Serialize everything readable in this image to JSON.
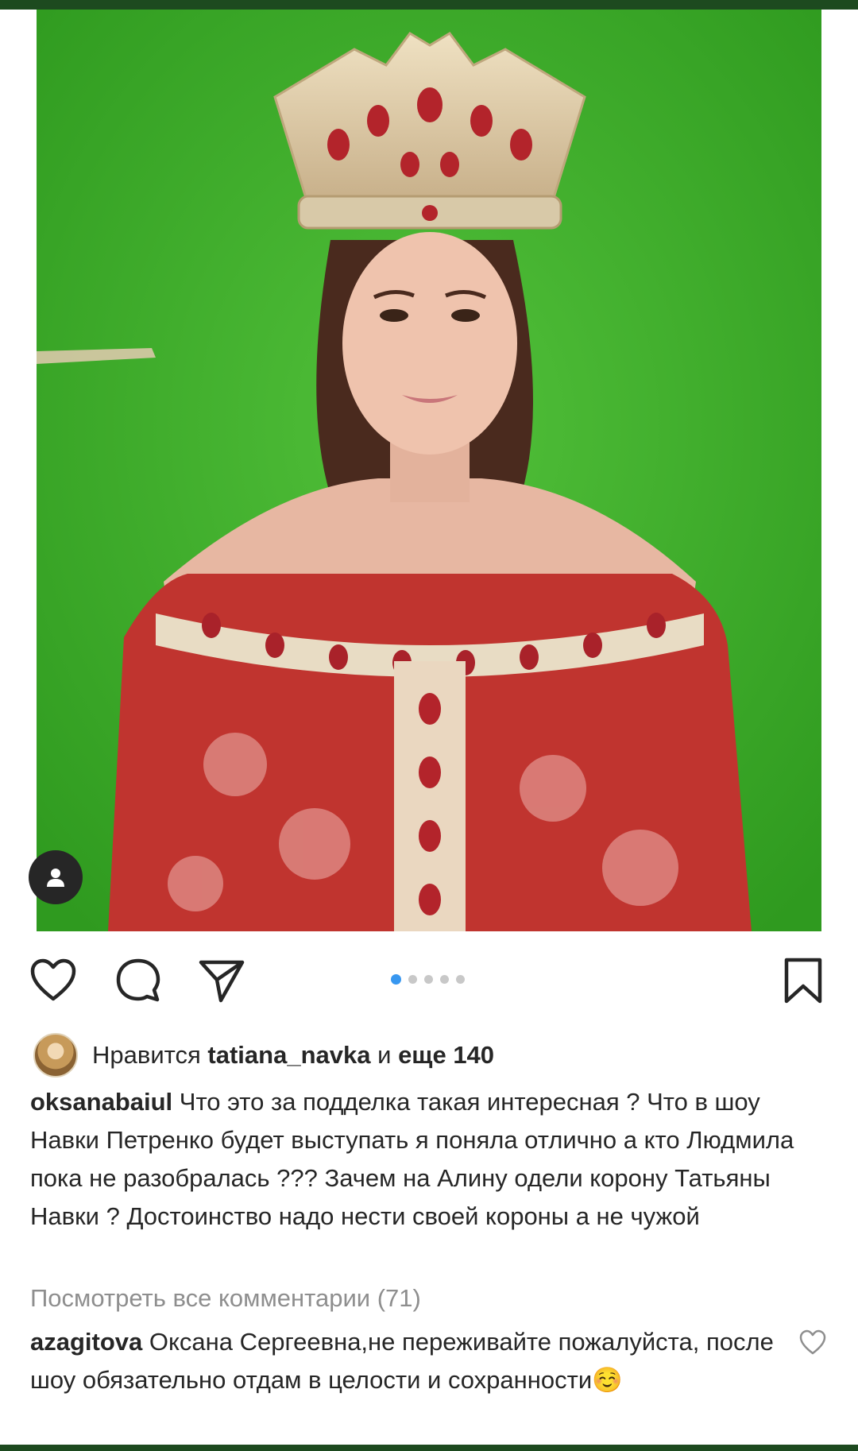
{
  "post": {
    "likes": {
      "prefix": "Нравится",
      "user": "tatiana_navka",
      "conjunction": "и",
      "rest": "еще 140"
    },
    "caption": {
      "username": "oksanabaiul",
      "text": " Что это за подделка такая интересная ? Что в шоу Навки Петренко будет выступать я поняла отлично а кто Людмила пока не разобралась ??? Зачем на Алину одели корону Татьяны Навки ? Достоинство надо нести своей короны а не чужой"
    },
    "view_all_comments": "Посмотреть все комментарии (71)",
    "top_comment": {
      "username": "azagitova",
      "text": " Оксана Сергеевна,не переживайте пожалуйста, после шоу обязательно отдам в целости и сохранности☺️"
    },
    "carousel": {
      "count": 5,
      "active_index": 0
    }
  },
  "colors": {
    "green_screen": "#3fb02b",
    "accent": "#3897f0",
    "text": "#262626",
    "muted": "#8e8e8e",
    "top_bar": "#1d4a1f"
  },
  "icons": [
    "heart-icon",
    "comment-icon",
    "send-icon",
    "bookmark-icon",
    "user-tag-icon",
    "comment-like-icon"
  ]
}
